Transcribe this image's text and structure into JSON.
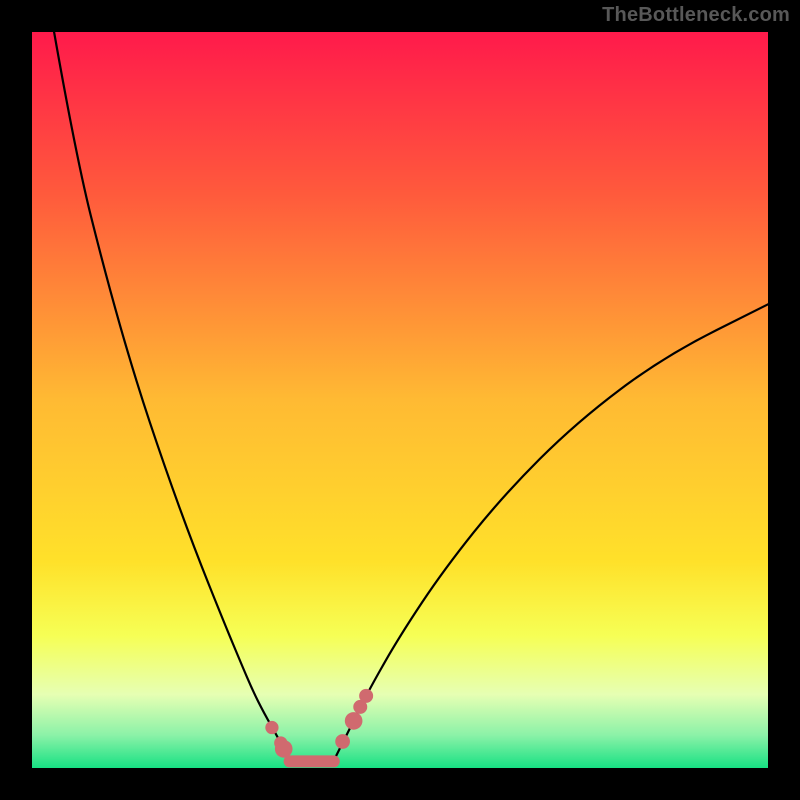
{
  "watermark": "TheBottleneck.com",
  "chart_data": {
    "type": "line",
    "title": "",
    "xlabel": "",
    "ylabel": "",
    "xlim": [
      0,
      100
    ],
    "ylim": [
      0,
      100
    ],
    "gradient_stops": [
      {
        "offset": 0,
        "color": "#ff1a4b"
      },
      {
        "offset": 0.22,
        "color": "#ff5a3c"
      },
      {
        "offset": 0.5,
        "color": "#ffba33"
      },
      {
        "offset": 0.72,
        "color": "#ffe12a"
      },
      {
        "offset": 0.82,
        "color": "#f6ff55"
      },
      {
        "offset": 0.9,
        "color": "#e6ffb3"
      },
      {
        "offset": 0.955,
        "color": "#8cf2a8"
      },
      {
        "offset": 1.0,
        "color": "#17e183"
      }
    ],
    "series": [
      {
        "name": "left-curve",
        "x": [
          3,
          6,
          10,
          14,
          18,
          22,
          26,
          28.5,
          30,
          31.5,
          33.5,
          35
        ],
        "y": [
          100,
          83,
          67,
          53,
          41,
          30,
          20,
          14,
          10.5,
          7.5,
          4,
          1
        ]
      },
      {
        "name": "right-curve",
        "x": [
          41,
          42.5,
          44,
          46,
          50,
          56,
          64,
          74,
          86,
          100
        ],
        "y": [
          1,
          4,
          7,
          11,
          18,
          27,
          37,
          47,
          56,
          63
        ]
      },
      {
        "name": "flat-bottom-segment",
        "x": [
          35,
          41
        ],
        "y": [
          0.9,
          0.9
        ]
      }
    ],
    "markers": [
      {
        "x": 32.6,
        "y": 5.5,
        "r": 0.9
      },
      {
        "x": 33.8,
        "y": 3.4,
        "r": 0.9
      },
      {
        "x": 34.2,
        "y": 2.6,
        "r": 1.2
      },
      {
        "x": 42.2,
        "y": 3.6,
        "r": 1.0
      },
      {
        "x": 43.7,
        "y": 6.4,
        "r": 1.2
      },
      {
        "x": 44.6,
        "y": 8.3,
        "r": 0.95
      },
      {
        "x": 45.4,
        "y": 9.8,
        "r": 0.95
      }
    ]
  }
}
